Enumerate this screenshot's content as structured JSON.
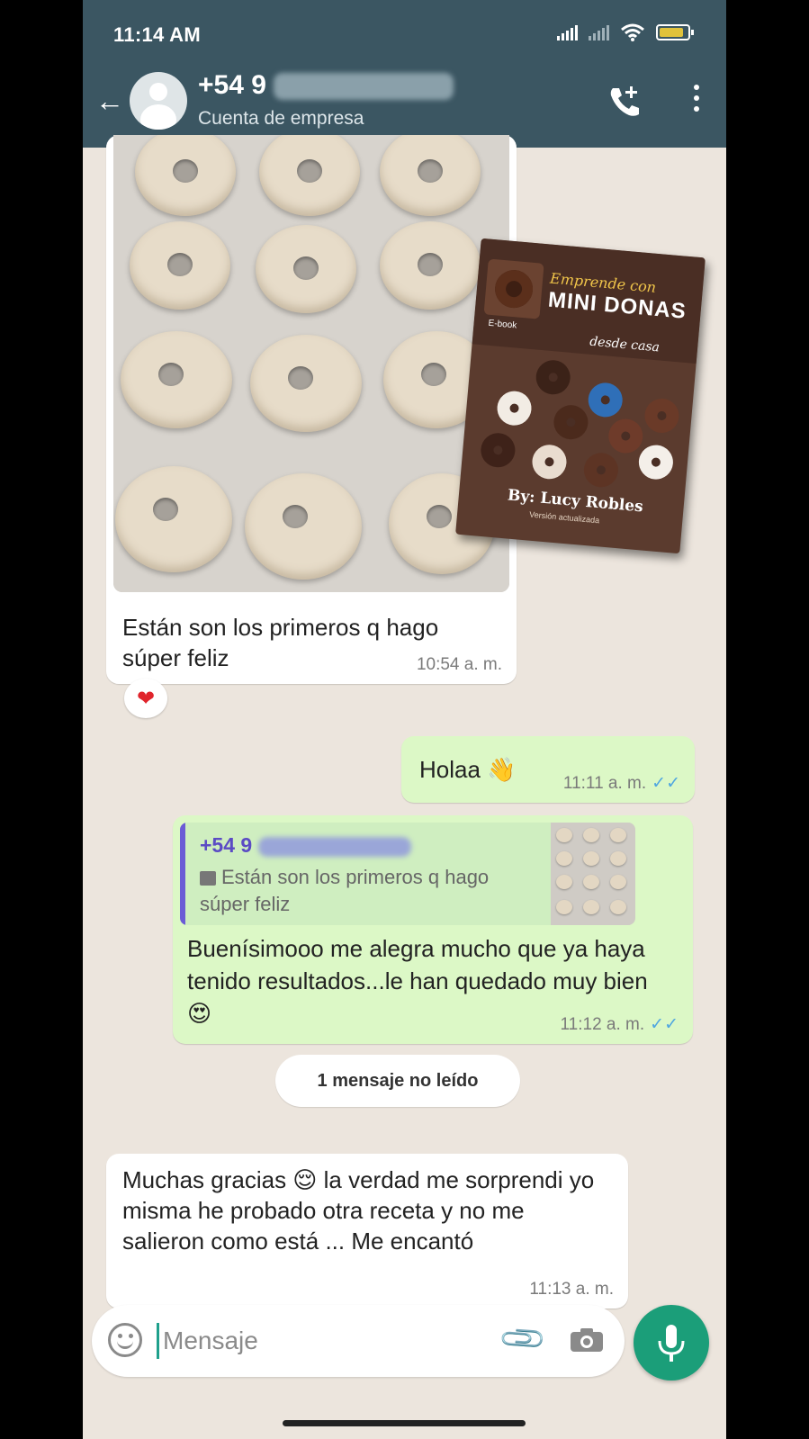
{
  "status_bar": {
    "time": "11:14 AM",
    "battery": "86"
  },
  "header": {
    "contact_prefix": "+54 9",
    "subtitle": "Cuenta de empresa",
    "back_icon": "arrow-left-icon",
    "call_icon": "add-call-icon",
    "menu_icon": "more-vertical-icon"
  },
  "messages": [
    {
      "id": "m1",
      "direction": "in",
      "has_photo": true,
      "text": "Están son los primeros q hago súper feliz",
      "time": "10:54 a. m.",
      "reaction": "❤"
    },
    {
      "id": "m2",
      "direction": "out",
      "text": "Holaa 👋",
      "time": "11:11 a. m.",
      "ticks": "✓✓"
    },
    {
      "id": "m3",
      "direction": "out",
      "quote": {
        "name": "+54 9",
        "text": "Están son los primeros q hago súper feliz"
      },
      "text": "Buenísimooo me alegra mucho que ya haya tenido resultados...le han quedado muy bien 😍",
      "time": "11:12 a. m.",
      "ticks": "✓✓"
    },
    {
      "id": "m4",
      "direction": "in",
      "text": "Muchas gracias 😌 la verdad me sorprendi yo misma he probado otra receta y no me salieron como está ... Me encantó",
      "time": "11:13 a. m."
    }
  ],
  "unread_divider": "1 mensaje no leído",
  "ebook": {
    "title_line1": "Emprende con",
    "title_line2": "MINI DONAS",
    "title_line3": "desde casa",
    "tag": "E-book",
    "author": "By: Lucy Robles",
    "version": "Versión actualizada"
  },
  "composer": {
    "placeholder": "Mensaje"
  },
  "colors": {
    "header": "#3b5662",
    "chat_bg": "#ece5dd",
    "outgoing": "#dcf8c6",
    "incoming": "#ffffff",
    "accent": "#1b9e79",
    "read_ticks": "#4fa6e0"
  }
}
